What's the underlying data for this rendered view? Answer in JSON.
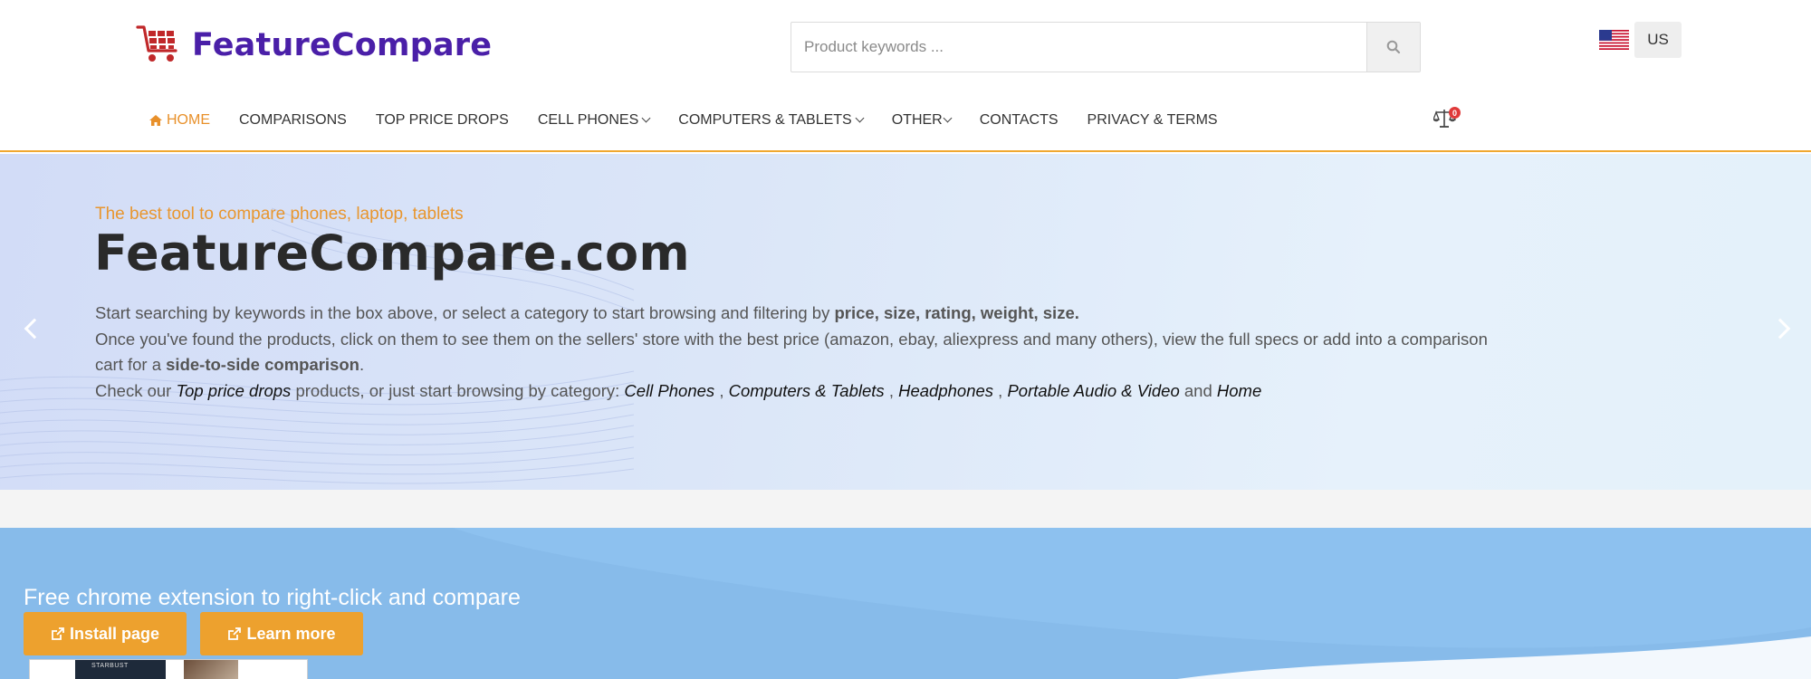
{
  "brand": {
    "name": "FeatureCompare",
    "logo_color": "#4a1fa8",
    "cart_color": "#c0282a"
  },
  "search": {
    "placeholder": "Product keywords ...",
    "value": "",
    "icon": "search-icon"
  },
  "country": {
    "code": "US",
    "flag": "us-flag-icon"
  },
  "nav": [
    {
      "label": "HOME",
      "active": true,
      "icon": "home-icon"
    },
    {
      "label": "COMPARISONS"
    },
    {
      "label": "TOP PRICE DROPS"
    },
    {
      "label": "CELL PHONES",
      "dropdown": true
    },
    {
      "label": "COMPUTERS & TABLETS",
      "dropdown": true
    },
    {
      "label": "OTHER",
      "dropdown": true
    },
    {
      "label": "CONTACTS"
    },
    {
      "label": "PRIVACY & TERMS"
    }
  ],
  "compare_cart": {
    "icon": "scale-icon",
    "count": "0"
  },
  "hero": {
    "subtitle": "The best tool to compare phones, laptop, tablets",
    "title": "FeatureCompare.com",
    "line1_text": "Start searching by keywords in the box above, or select a category to start browsing and filtering by ",
    "line1_bold": "price, size, rating, weight, size.",
    "line2_text": "Once you've found the products, click on them to see them on the sellers' store with the best price (amazon, ebay, aliexpress and many others), view the full specs or add into a comparison cart for a ",
    "line2_bold": "side-to-side comparison",
    "line2_end": ".",
    "line3_prefix": "Check our ",
    "line3_link1": "Top price drops",
    "line3_mid": " products, or just start browsing by category: ",
    "categories": [
      "Cell Phones",
      "Computers & Tablets",
      "Headphones",
      "Portable Audio & Video"
    ],
    "sep": " , ",
    "and": " and ",
    "last_category": "Home"
  },
  "extension": {
    "title": "Free chrome extension to right-click and compare",
    "install_label": "Install page",
    "learn_label": "Learn more",
    "button_color": "#eda12e",
    "preview_text": "STARBUST"
  },
  "colors": {
    "accent": "#e8902a",
    "banner": "#87bbea"
  }
}
